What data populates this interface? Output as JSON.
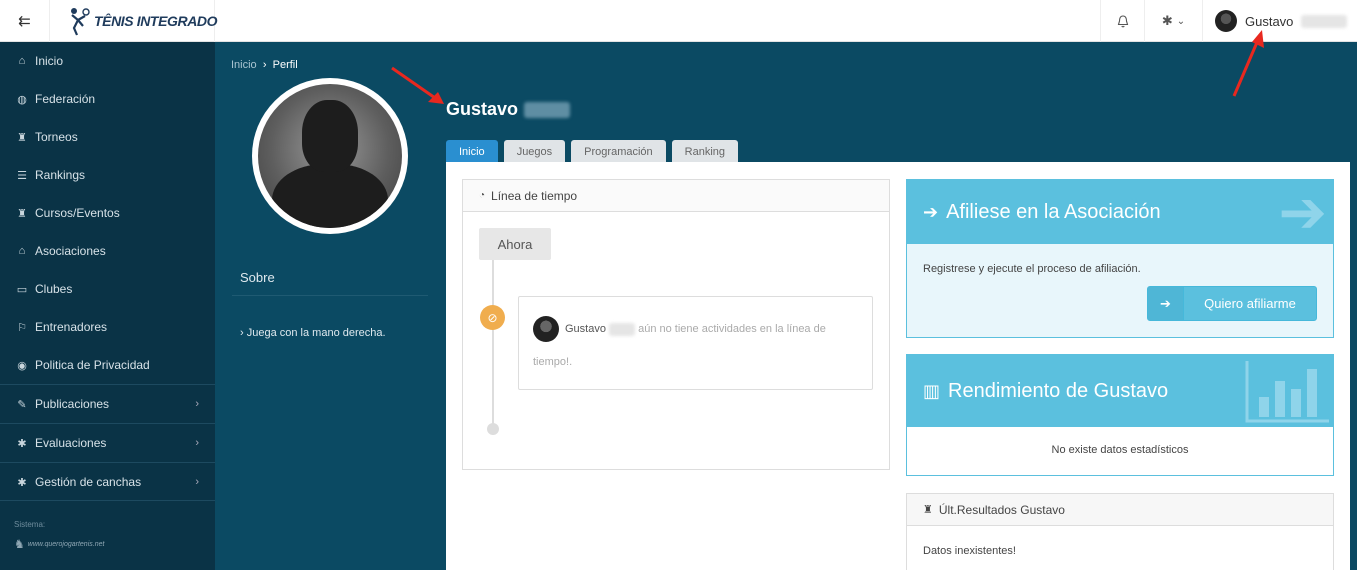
{
  "app": {
    "logo_text": "TÊNIS INTEGRADO"
  },
  "topbar": {
    "user_name": "Gustavo"
  },
  "sidebar": {
    "items": [
      {
        "label": "Inicio",
        "icon": "home-icon",
        "glyph": "⌂"
      },
      {
        "label": "Federación",
        "icon": "globe-icon",
        "glyph": "◍"
      },
      {
        "label": "Torneos",
        "icon": "trophy-icon",
        "glyph": "♜"
      },
      {
        "label": "Rankings",
        "icon": "list-icon",
        "glyph": "☰"
      },
      {
        "label": "Cursos/Eventos",
        "icon": "trophy-icon",
        "glyph": "♜"
      },
      {
        "label": "Asociaciones",
        "icon": "bank-icon",
        "glyph": "⌂"
      },
      {
        "label": "Clubes",
        "icon": "folder-icon",
        "glyph": "▭"
      },
      {
        "label": "Entrenadores",
        "icon": "flag-icon",
        "glyph": "⚐"
      },
      {
        "label": "Politica de Privacidad",
        "icon": "users-icon",
        "glyph": "◉"
      }
    ],
    "expandable": [
      {
        "label": "Publicaciones",
        "icon": "edit-icon",
        "glyph": "✎"
      },
      {
        "label": "Evaluaciones",
        "icon": "gear-icon",
        "glyph": "✱"
      },
      {
        "label": "Gestión de canchas",
        "icon": "gear-icon",
        "glyph": "✱"
      }
    ],
    "system_label": "Sistema:",
    "system_logo": "www.querojogartenis.net"
  },
  "breadcrumb": {
    "home": "Inicio",
    "separator": "›",
    "current": "Perfil"
  },
  "profile": {
    "name": "Gustavo",
    "sobre_title": "Sobre",
    "sobre_items": [
      "Juega con la mano derecha."
    ]
  },
  "tabs": [
    "Inicio",
    "Juegos",
    "Programación",
    "Ranking"
  ],
  "timeline": {
    "title": "Línea de tiempo",
    "now_label": "Ahora",
    "entry_name": "Gustavo",
    "entry_text": "aún no tiene actividades en la línea de tiempo!."
  },
  "affiliate": {
    "title": "Afiliese en la Asociación",
    "text": "Registrese y ejecute el proceso de afiliación.",
    "button": "Quiero afiliarme"
  },
  "performance": {
    "title": "Rendimiento de Gustavo",
    "empty": "No existe datos estadísticos"
  },
  "results": {
    "title": "Últ.Resultados Gustavo",
    "empty": "Datos inexistentes!"
  },
  "colors": {
    "accent": "#2a8fd0",
    "info": "#5bc0de",
    "sidebar": "#0a3346",
    "page": "#0b4a63",
    "warning": "#f0ad4e",
    "arrow": "#e8281f"
  }
}
